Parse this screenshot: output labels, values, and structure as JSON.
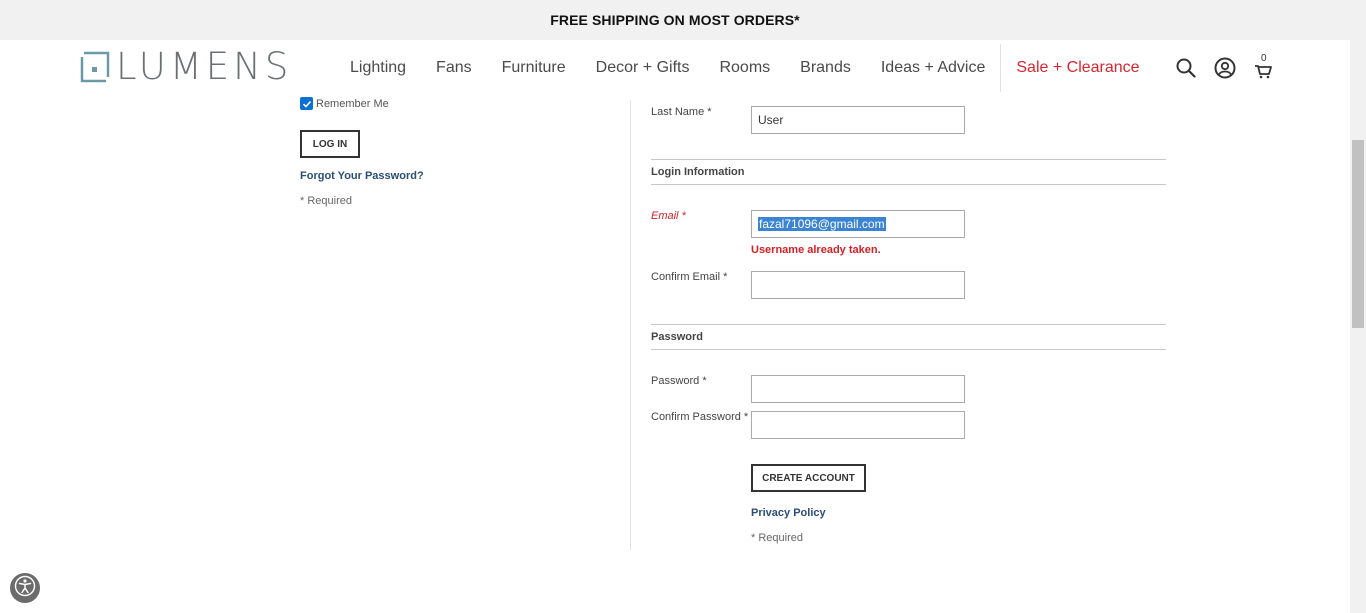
{
  "promo": {
    "text": "FREE SHIPPING ON MOST ORDERS*"
  },
  "brand": {
    "logo_text": "LUMENS",
    "logo_icon": "lumens-logo-mark"
  },
  "nav": {
    "items": [
      {
        "label": "Lighting"
      },
      {
        "label": "Fans"
      },
      {
        "label": "Furniture"
      },
      {
        "label": "Decor + Gifts"
      },
      {
        "label": "Rooms"
      },
      {
        "label": "Brands"
      },
      {
        "label": "Ideas + Advice"
      }
    ],
    "sale_label": "Sale + Clearance",
    "sale_color": "#d9262e"
  },
  "header_icons": {
    "search": "search-icon",
    "account": "account-icon",
    "cart": "cart-icon",
    "cart_count": "0"
  },
  "login": {
    "remember_label": "Remember Me",
    "remember_checked": true,
    "login_button": "LOG IN",
    "forgot_link": "Forgot Your Password?",
    "required_note": "* Required"
  },
  "register": {
    "last_name_label": "Last Name *",
    "last_name_value": "User",
    "login_info_title": "Login Information",
    "email_label": "Email *",
    "email_value": "fazal71096@gmail.com",
    "email_error": "Username already taken.",
    "confirm_email_label": "Confirm Email *",
    "confirm_email_value": "",
    "password_title": "Password",
    "password_label": "Password *",
    "confirm_password_label": "Confirm Password *",
    "create_button": "CREATE ACCOUNT",
    "privacy_link": "Privacy Policy",
    "required_note": "* Required"
  },
  "accessibility": {
    "icon": "accessibility-icon"
  },
  "colors": {
    "error": "#d41f24",
    "link": "#2a4d77",
    "selection": "#3b84d4"
  }
}
